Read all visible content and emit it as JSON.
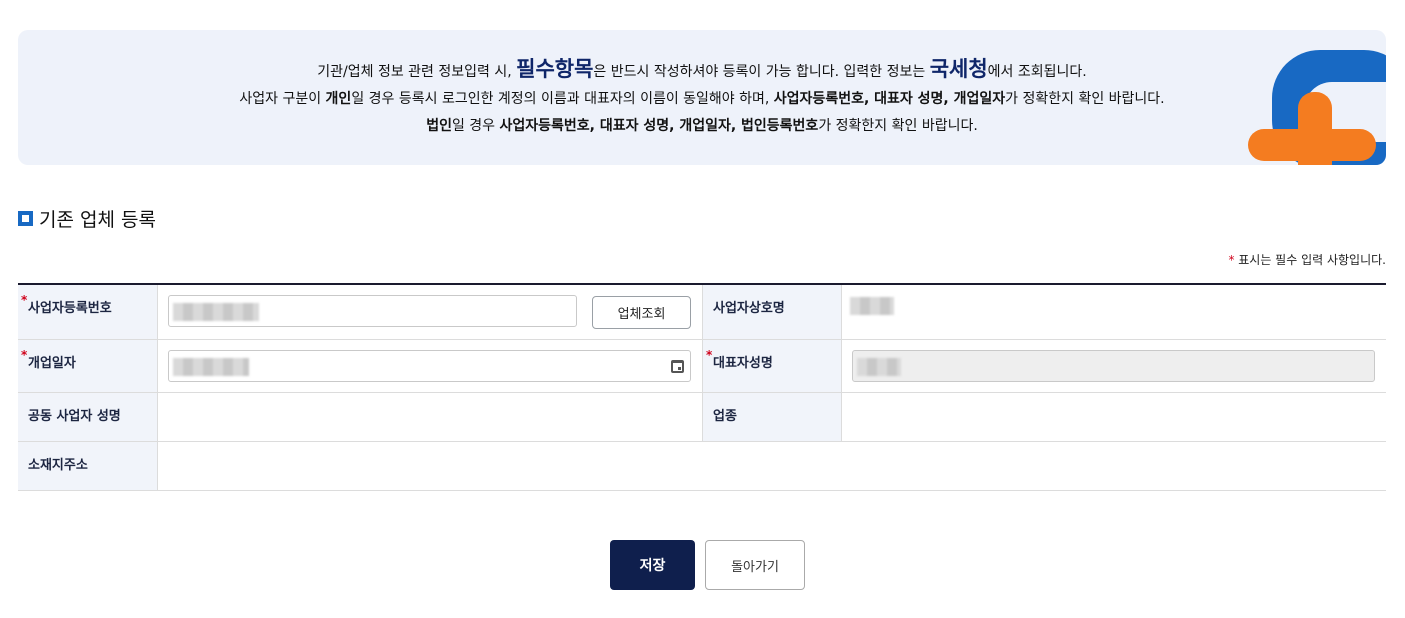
{
  "notice": {
    "line1_a": "기관/업체 정보 관련 정보입력 시, ",
    "line1_big1": "필수항목",
    "line1_b": "은 반드시 작성하셔야 등록이 가능 합니다. 입력한 정보는 ",
    "line1_big2": "국세청",
    "line1_c": "에서 조회됩니다.",
    "line2_a": "사업자 구분이 ",
    "line2_b1": "개인",
    "line2_b": "일 경우 등록시 로그인한 계정의 이름과 대표자의 이름이 동일해야 하며, ",
    "line2_b2": "사업자등록번호, 대표자 성명, 개업일자",
    "line2_c": "가 정확한지 확인 바랍니다.",
    "line3_b1": "법인",
    "line3_a": "일 경우 ",
    "line3_b2": "사업자등록번호, 대표자 성명, 개업일자, 법인등록번호",
    "line3_c": "가 정확한지 확인 바랍니다."
  },
  "section": {
    "title": "기존 업체 등록"
  },
  "required_note": {
    "star": "*",
    "text": " 표시는 필수 입력 사항입니다."
  },
  "form": {
    "biz_reg_no_label": "사업자등록번호",
    "lookup_button": "업체조회",
    "biz_name_label": "사업자상호명",
    "open_date_label": "개업일자",
    "rep_name_label": "대표자성명",
    "joint_rep_label": "공동 사업자 성명",
    "industry_label": "업종",
    "address_label": "소재지주소",
    "required_star": "*"
  },
  "buttons": {
    "save": "저장",
    "back": "돌아가기"
  },
  "colors": {
    "primary": "#0f1f4d",
    "accent_blue": "#1869c3",
    "accent_orange": "#f47c20",
    "required": "#d0021b"
  }
}
